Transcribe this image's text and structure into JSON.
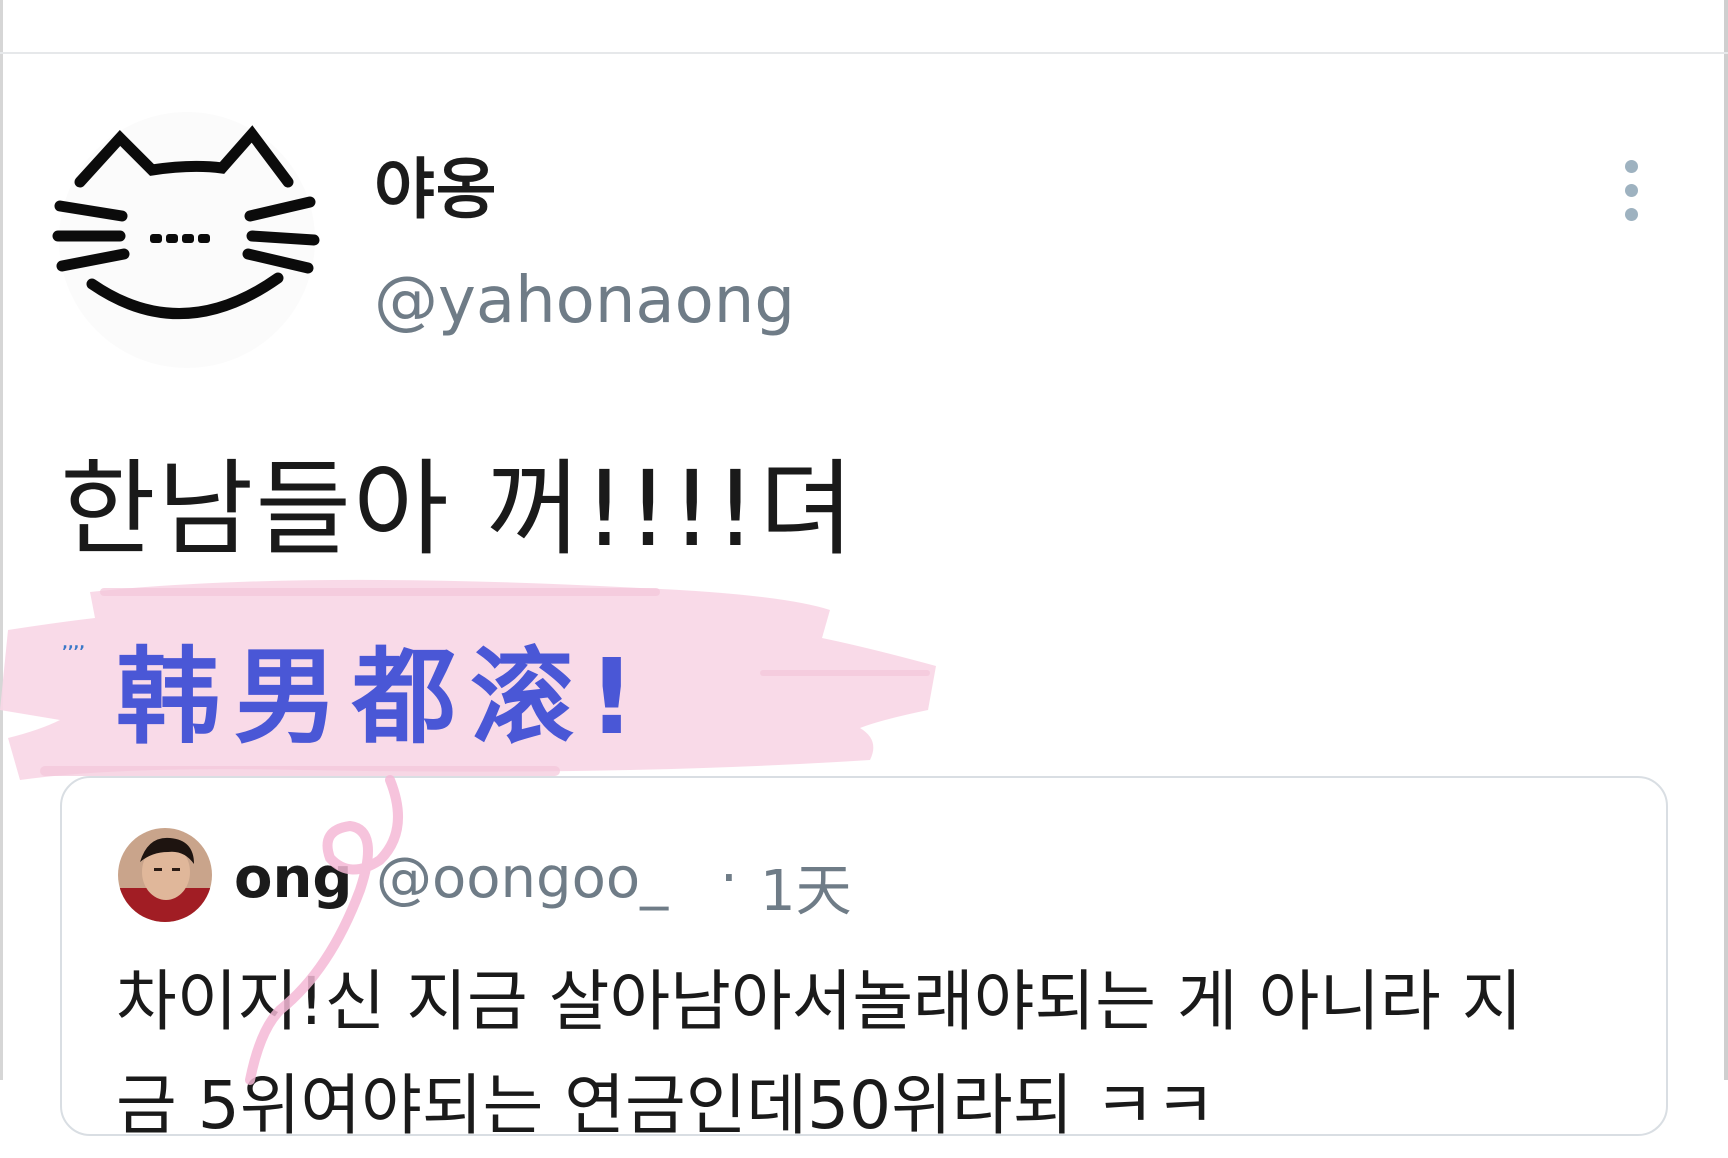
{
  "tweet": {
    "author_name": "야옹",
    "author_handle": "@yahonaong",
    "text": "한남들아 꺼!!!!뎌",
    "avatar_icon": "cat-face-icon",
    "more_icon": "more-vertical-icon"
  },
  "overlay": {
    "caption": "韩男都滚!",
    "tiny_mark": "‚‚‚‚"
  },
  "quoted_tweet": {
    "author_name": "ong",
    "author_handle": "@oongoo_",
    "separator": "·",
    "time": "1天",
    "text_lines": [
      "차이지!신 지금 살아남아서놀래야되는 게 아니라 지",
      "금 5위여야되는 연금인데50위라되 ㅋㅋ"
    ]
  },
  "colors": {
    "caption": "#4a57d6",
    "brush": "#f8d7e6",
    "handle": "#6f7c87",
    "border": "#d9dee3"
  }
}
